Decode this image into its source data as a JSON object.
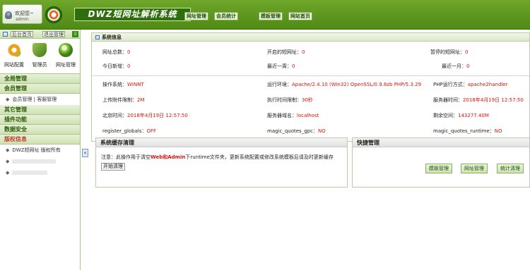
{
  "header": {
    "welcome_line1": "欢迎您~",
    "welcome_line2": "admin",
    "app_title": "DWZ短网址解析系统",
    "nav": [
      "网址管理",
      "会员统计",
      "模板管理",
      "网站首页"
    ]
  },
  "sidebar": {
    "top_buttons": [
      "后台首页",
      "退出管理"
    ],
    "download_icon": "⇩",
    "shortcuts": [
      {
        "label": "网站配置",
        "icon": "gear-icon",
        "color": "#e8a31c"
      },
      {
        "label": "管理员",
        "icon": "shield-icon",
        "color": "#6d9e3a"
      },
      {
        "label": "网址管理",
        "icon": "globe-icon",
        "color": "#3f7d16"
      }
    ],
    "sections": [
      {
        "title": "全局管理",
        "items": []
      },
      {
        "title": "会员管理",
        "items": [
          "会员管理 | 客服管理"
        ]
      },
      {
        "title": "其它管理",
        "items": []
      },
      {
        "title": "插件功能",
        "items": []
      },
      {
        "title": "数据安全",
        "items": []
      },
      {
        "title": "版权信息",
        "active": true,
        "items": [
          "DWZ短网址 版权所有"
        ]
      }
    ],
    "collapse_glyph": "«"
  },
  "system_info": {
    "title": "系统信息",
    "row1": [
      {
        "label": "网址总数：",
        "value": "0"
      },
      {
        "label": "开启的短网址：",
        "value": "0"
      },
      {
        "label": "暂停的短网址：",
        "value": "0"
      }
    ],
    "row2": [
      {
        "label": "今日新增：",
        "value": "0"
      },
      {
        "label": "最近一周：",
        "value": "0"
      },
      {
        "label": "最近一月：",
        "value": "0"
      }
    ],
    "env": [
      {
        "label": "操作系统：",
        "value": "WINNT"
      },
      {
        "label": "运行环境：",
        "value": "Apache/2.4.10 (Win32) OpenSSL/0.9.8zb PHP/5.3.29"
      },
      {
        "label": "PHP运行方式：",
        "value": "apache2handler"
      },
      {
        "label": "上传附件限制：",
        "value": "2M"
      },
      {
        "label": "执行时间限制：",
        "value": "30秒"
      },
      {
        "label": "服务器时间：",
        "value": "2018年4月19日 12:57:50"
      },
      {
        "label": "北京时间：",
        "value": "2018年4月19日 12:57:50"
      },
      {
        "label": "服务器域名：",
        "value": "localhost"
      },
      {
        "label": "剩余空间：",
        "value": "143277.40M"
      },
      {
        "label": "register_globals：",
        "value": "OFF"
      },
      {
        "label": "magic_quotes_gpc：",
        "value": "NO"
      },
      {
        "label": "magic_quotes_runtime：",
        "value": "NO"
      }
    ]
  },
  "cache": {
    "title": "系统缓存清理",
    "note_prefix": "注意：此操作用于清空",
    "note_red": "Web和Admin",
    "note_suffix": "下runtime文件夹，更新系统配置或修改系统模板后请及时更新缓存",
    "button": "开始清理"
  },
  "quick": {
    "title": "快捷管理",
    "buttons": [
      "模板管理",
      "网址管理",
      "统计清理"
    ]
  },
  "colors": {
    "accent": "#4f8a14",
    "value_red": "#d9140f"
  }
}
